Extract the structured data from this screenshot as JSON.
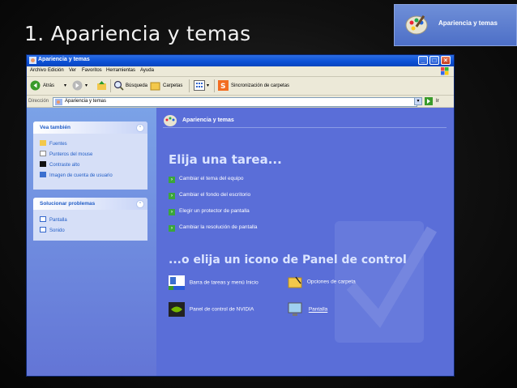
{
  "slide": {
    "title": "1. Apariencia y temas"
  },
  "corner_banner": {
    "label": "Apariencia y temas"
  },
  "window": {
    "title": "Apariencia y temas",
    "menu": [
      "Archivo",
      "Edición",
      "Ver",
      "Favoritos",
      "Herramientas",
      "Ayuda"
    ],
    "toolbar": {
      "back": "Atrás",
      "search": "Búsqueda",
      "folders": "Carpetas",
      "sync": "Sincronización de carpetas"
    },
    "address": {
      "label": "Dirección",
      "value": "Apariencia y temas",
      "go": "Ir"
    }
  },
  "see_also": {
    "title": "Vea también",
    "items": [
      "Fuentes",
      "Punteros del mouse",
      "Contraste alto",
      "Imagen de cuenta de usuario"
    ]
  },
  "troubleshoot": {
    "title": "Solucionar problemas",
    "items": [
      "Pantalla",
      "Sonido"
    ]
  },
  "main": {
    "header": "Apariencia y temas",
    "pick_task": "Elija una tarea...",
    "tasks": [
      "Cambiar el tema del equipo",
      "Cambiar el fondo del escritorio",
      "Elegir un protector de pantalla",
      "Cambiar la resolución de pantalla"
    ],
    "pick_icon": "...o elija un icono de Panel de control",
    "icons": [
      "Barra de tareas y menú Inicio",
      "Opciones de carpeta",
      "Panel de control de NVIDIA",
      "Pantalla"
    ]
  }
}
